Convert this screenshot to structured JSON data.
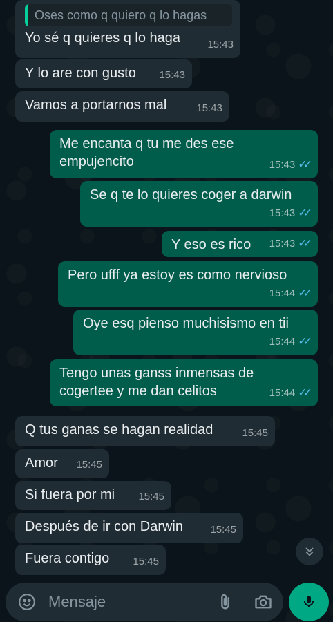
{
  "chat": {
    "quoted_text": "Oses como q quiero q lo hagas",
    "messages": [
      {
        "dir": "in",
        "text": "Yo sé q quieres q lo haga",
        "time": "15:43"
      },
      {
        "dir": "in",
        "text": "Y lo are con gusto",
        "time": "15:43"
      },
      {
        "dir": "in",
        "text": "Vamos a portarnos mal",
        "time": "15:43"
      },
      {
        "dir": "out",
        "text": "Me encanta q tu me des ese empujencito",
        "time": "15:43",
        "read": true
      },
      {
        "dir": "out",
        "text": "Se q te lo quieres coger a darwin",
        "time": "15:43",
        "read": true
      },
      {
        "dir": "out",
        "text": "Y eso es rico",
        "time": "15:43",
        "read": true
      },
      {
        "dir": "out",
        "text": "Pero ufff ya estoy es como nervioso",
        "time": "15:44",
        "read": true
      },
      {
        "dir": "out",
        "text": "Oye esq pienso muchisismo en tii",
        "time": "15:44",
        "read": true
      },
      {
        "dir": "out",
        "text": "Tengo unas ganss inmensas de cogertee  y me dan celitos",
        "time": "15:44",
        "read": true
      },
      {
        "dir": "in",
        "text": "Q tus ganas se hagan realidad",
        "time": "15:45"
      },
      {
        "dir": "in",
        "text": "Amor",
        "time": "15:45"
      },
      {
        "dir": "in",
        "text": "Si fuera por mi",
        "time": "15:45"
      },
      {
        "dir": "in",
        "text": "Después de ir con Darwin",
        "time": "15:45"
      },
      {
        "dir": "in",
        "text": "Fuera contigo",
        "time": "15:45"
      }
    ]
  },
  "composer": {
    "placeholder": "Mensaje"
  },
  "icons": {
    "emoji": "emoji-icon",
    "attach": "paperclip-icon",
    "camera": "camera-icon",
    "mic": "mic-icon",
    "scroll": "chevron-double-down-icon"
  },
  "colors": {
    "incoming_bubble": "#202c33",
    "outgoing_bubble": "#005c4b",
    "read_ticks": "#53bdeb",
    "accent": "#00a884"
  }
}
